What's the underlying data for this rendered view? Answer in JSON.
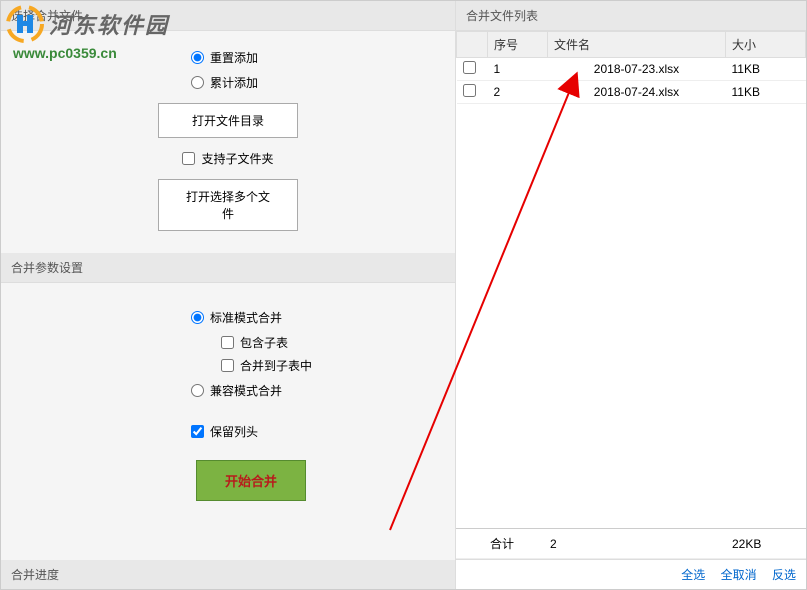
{
  "watermark": {
    "text": "河东软件园",
    "url": "www.pc0359.cn"
  },
  "left": {
    "section1_title": "选择合并文件",
    "radio_reset": "重置添加",
    "radio_accum": "累计添加",
    "btn_open_dir": "打开文件目录",
    "chk_subfolder": "支持子文件夹",
    "btn_open_files": "打开选择多个文件",
    "section2_title": "合并参数设置",
    "radio_standard": "标准模式合并",
    "chk_include_sub": "包含子表",
    "chk_merge_to_sub": "合并到子表中",
    "radio_compat": "兼容模式合并",
    "chk_keep_header": "保留列头",
    "btn_start": "开始合并",
    "progress_title": "合并进度"
  },
  "right": {
    "title": "合并文件列表",
    "col_seq": "序号",
    "col_name": "文件名",
    "col_size": "大小",
    "rows": [
      {
        "seq": "1",
        "name": "2018-07-23.xlsx",
        "size": "11KB"
      },
      {
        "seq": "2",
        "name": "2018-07-24.xlsx",
        "size": "11KB"
      }
    ],
    "total_label": "合计",
    "total_count": "2",
    "total_size": "22KB",
    "link_all": "全选",
    "link_none": "全取消",
    "link_invert": "反选"
  }
}
